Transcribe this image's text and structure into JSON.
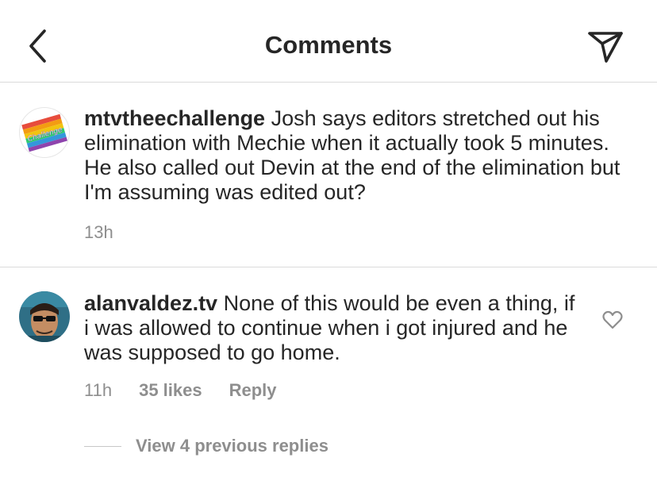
{
  "header": {
    "title": "Comments",
    "back_icon": "chevron-left-icon",
    "send_icon": "paper-plane-icon"
  },
  "caption": {
    "username": "mtvtheechallenge",
    "text": " Josh says editors stretched out his elimination with Mechie when it actually took 5 minutes. He also called out Devin at the end of the elimination but I'm assuming was edited out?",
    "timestamp": "13h",
    "avatar_text": "Challenge"
  },
  "comment": {
    "username": "alanvaldez.tv",
    "text": " None of this would be even a thing,  if i was allowed to continue when i got injured and he was supposed to go home.",
    "timestamp": "11h",
    "likes": "35 likes",
    "reply_label": "Reply",
    "heart_icon": "heart-outline-icon"
  },
  "replies": {
    "label": "View 4 previous replies"
  },
  "colors": {
    "text": "#262626",
    "secondary": "#8e8e8e",
    "divider": "#dbdbdb"
  }
}
